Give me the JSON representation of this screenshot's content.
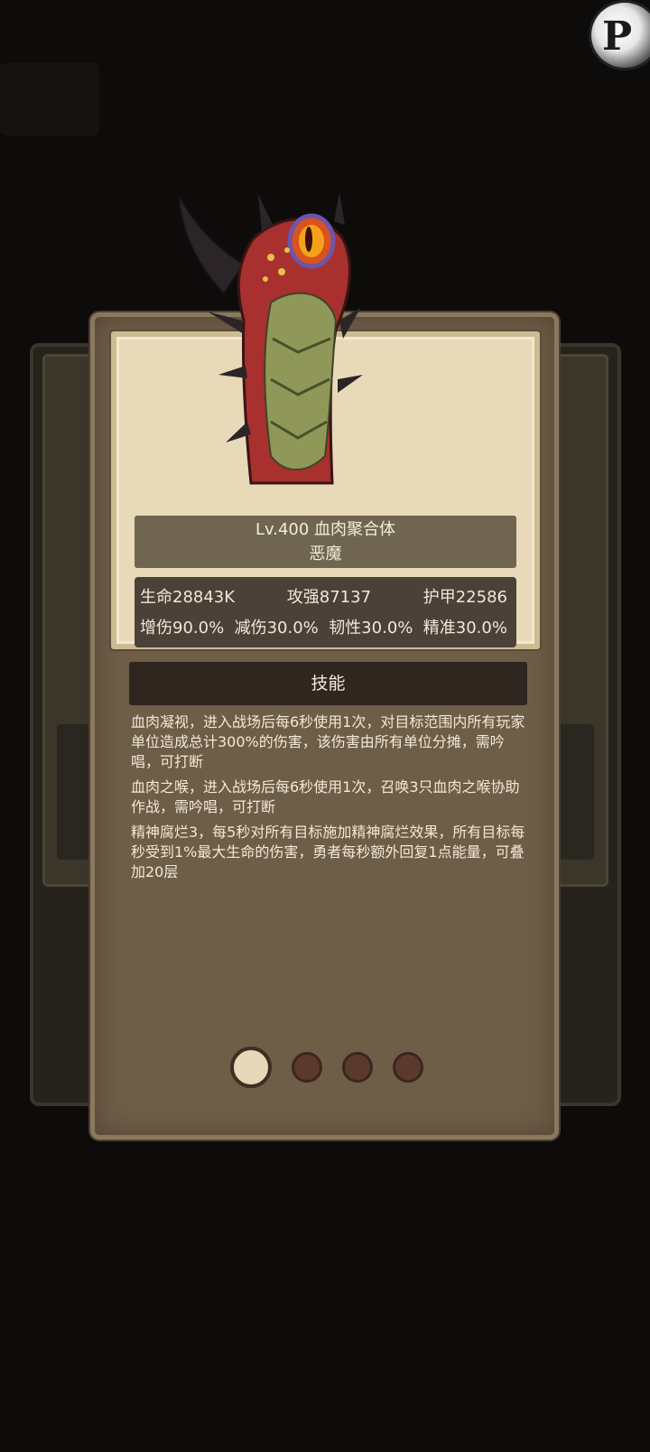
{
  "corner_badge": {
    "glyph": "P"
  },
  "unit": {
    "title": "Lv.400 血肉聚合体",
    "type": "恶魔",
    "stats_row1": [
      "生命28843K",
      "攻强87137",
      "护甲22586"
    ],
    "stats_row2": [
      "增伤90.0%",
      "减伤30.0%",
      "韧性30.0%",
      "精准30.0%"
    ]
  },
  "skills": {
    "header": "技能",
    "items": [
      "血肉凝视，进入战场后每6秒使用1次，对目标范围内所有玩家单位造成总计300%的伤害，该伤害由所有单位分摊，需吟唱，可打断",
      "血肉之喉，进入战场后每6秒使用1次，召唤3只血肉之喉协助作战，需吟唱，可打断",
      "精神腐烂3，每5秒对所有目标施加精神腐烂效果，所有目标每秒受到1%最大生命的伤害，勇者每秒额外回复1点能量，可叠加20层"
    ]
  },
  "pager": {
    "count": 4,
    "active_index": 0
  },
  "colors": {
    "card": "#6e5d47",
    "frame": "#e8d9b9",
    "active_dot": "#e6d8b8",
    "inactive_dot": "#5b3a2c"
  }
}
